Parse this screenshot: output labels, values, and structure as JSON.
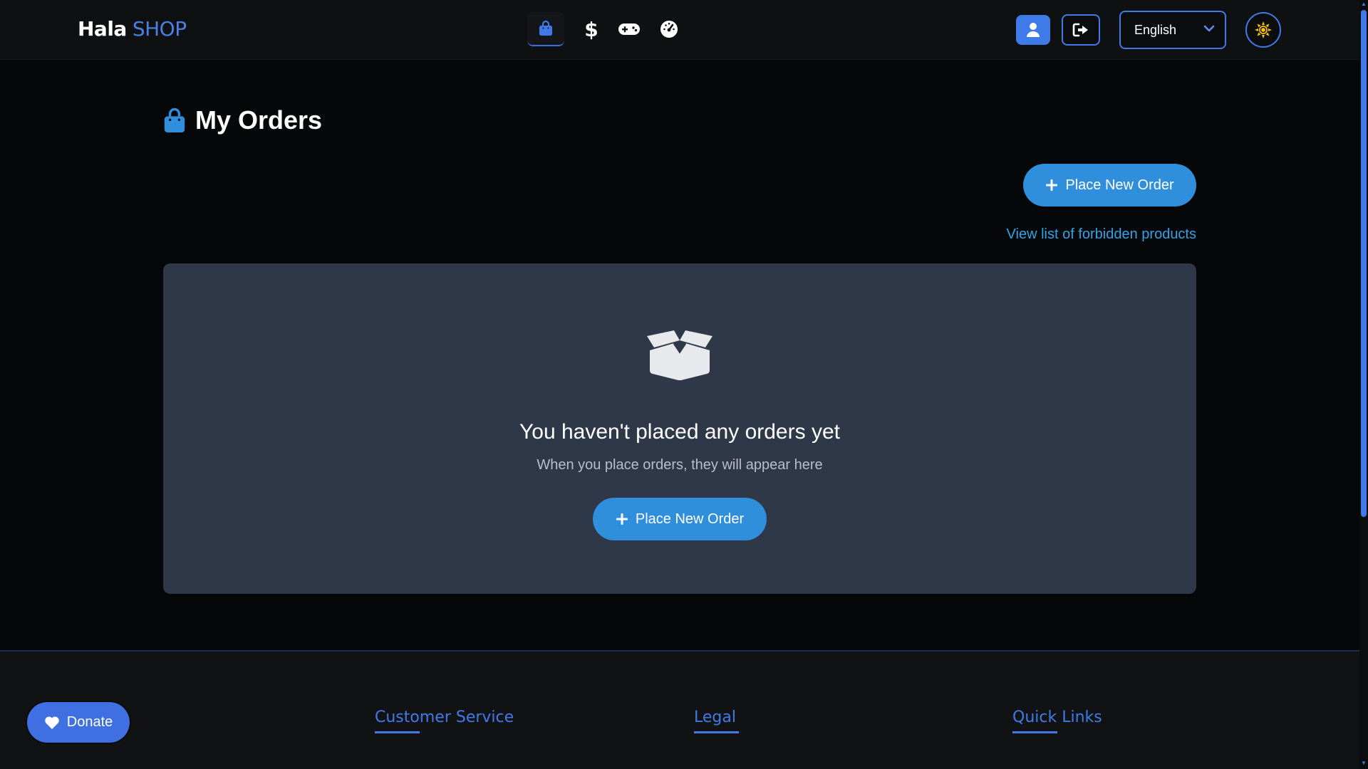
{
  "header": {
    "brand_part1": "Hala",
    "brand_part2": "SHOP",
    "nav": [
      {
        "name": "orders",
        "icon": "shopping-bag-icon",
        "active": true
      },
      {
        "name": "pricing",
        "icon": "dollar-icon",
        "active": false
      },
      {
        "name": "games",
        "icon": "gamepad-icon",
        "active": false
      },
      {
        "name": "dashboard",
        "icon": "speedometer-icon",
        "active": false
      }
    ],
    "user_icon": "user-icon",
    "logout_icon": "sign-out-icon",
    "language": {
      "selected": "English"
    },
    "theme_icon": "sun-icon"
  },
  "main": {
    "title": "My Orders",
    "place_order_label": "Place New Order",
    "forbidden_link": "View list of forbidden products",
    "empty": {
      "title": "You haven't placed any orders yet",
      "subtitle": "When you place orders, they will appear here",
      "button_label": "Place New Order"
    }
  },
  "footer": {
    "donate_label": "Donate",
    "headings": [
      "Customer Service",
      "Legal",
      "Quick Links"
    ]
  },
  "colors": {
    "accent": "#3f7be8",
    "button": "#2f8fdc",
    "link": "#2fa4e7",
    "card": "#2f3848",
    "sun": "#f4c20d"
  }
}
